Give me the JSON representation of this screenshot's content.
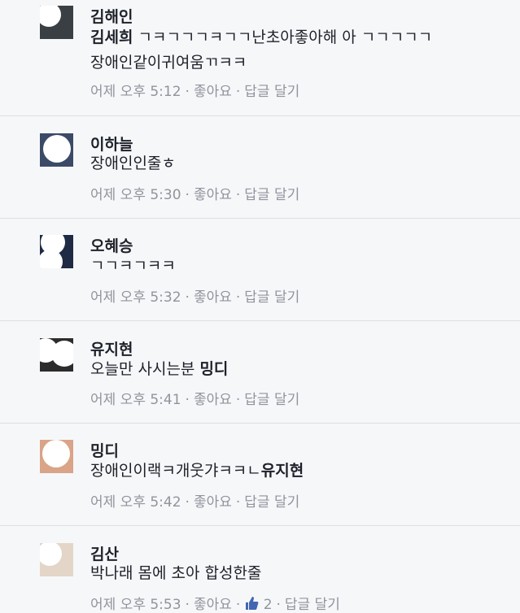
{
  "comments": [
    {
      "name": "김해인",
      "tag": "김세희",
      "text_line1": " ㄱㅋㄱㄱㄱㅋㄱㄱ난초아좋아해 아 ㄱㄱㄱㄱㄱ",
      "text_line2": "장애인같이귀여움ㄲㅋㅋ",
      "time": "어제 오후 5:12",
      "like": "좋아요",
      "reply": "답글 달기"
    },
    {
      "name": "이하늘",
      "text_line1": "장애인인줄ㅎ",
      "time": "어제 오후 5:30",
      "like": "좋아요",
      "reply": "답글 달기"
    },
    {
      "name": "오혜승",
      "text_line1": "ㄱㄱㅋㄱㅋㅋ",
      "time": "어제 오후 5:32",
      "like": "좋아요",
      "reply": "답글 달기"
    },
    {
      "name": "유지현",
      "text_line1": "오늘만 사시는분 ",
      "tag": "밍디",
      "time": "어제 오후 5:41",
      "like": "좋아요",
      "reply": "답글 달기"
    },
    {
      "name": "밍디",
      "text_line1": "장애인이랙ㅋ개웃갸ㅋㅋㄴ",
      "tag": "유지현",
      "time": "어제 오후 5:42",
      "like": "좋아요",
      "reply": "답글 달기"
    },
    {
      "name": "김산",
      "text_line1": "박나래 몸에 초아 합성한줄",
      "time": "어제 오후 5:53",
      "like": "좋아요",
      "like_count": "2",
      "reply": "답글 달기",
      "like_icon": "thumbs-up-icon"
    }
  ],
  "colors": {
    "meta": "#90949c",
    "like_blue": "#4267b2",
    "bg": "#f6f7f9"
  }
}
